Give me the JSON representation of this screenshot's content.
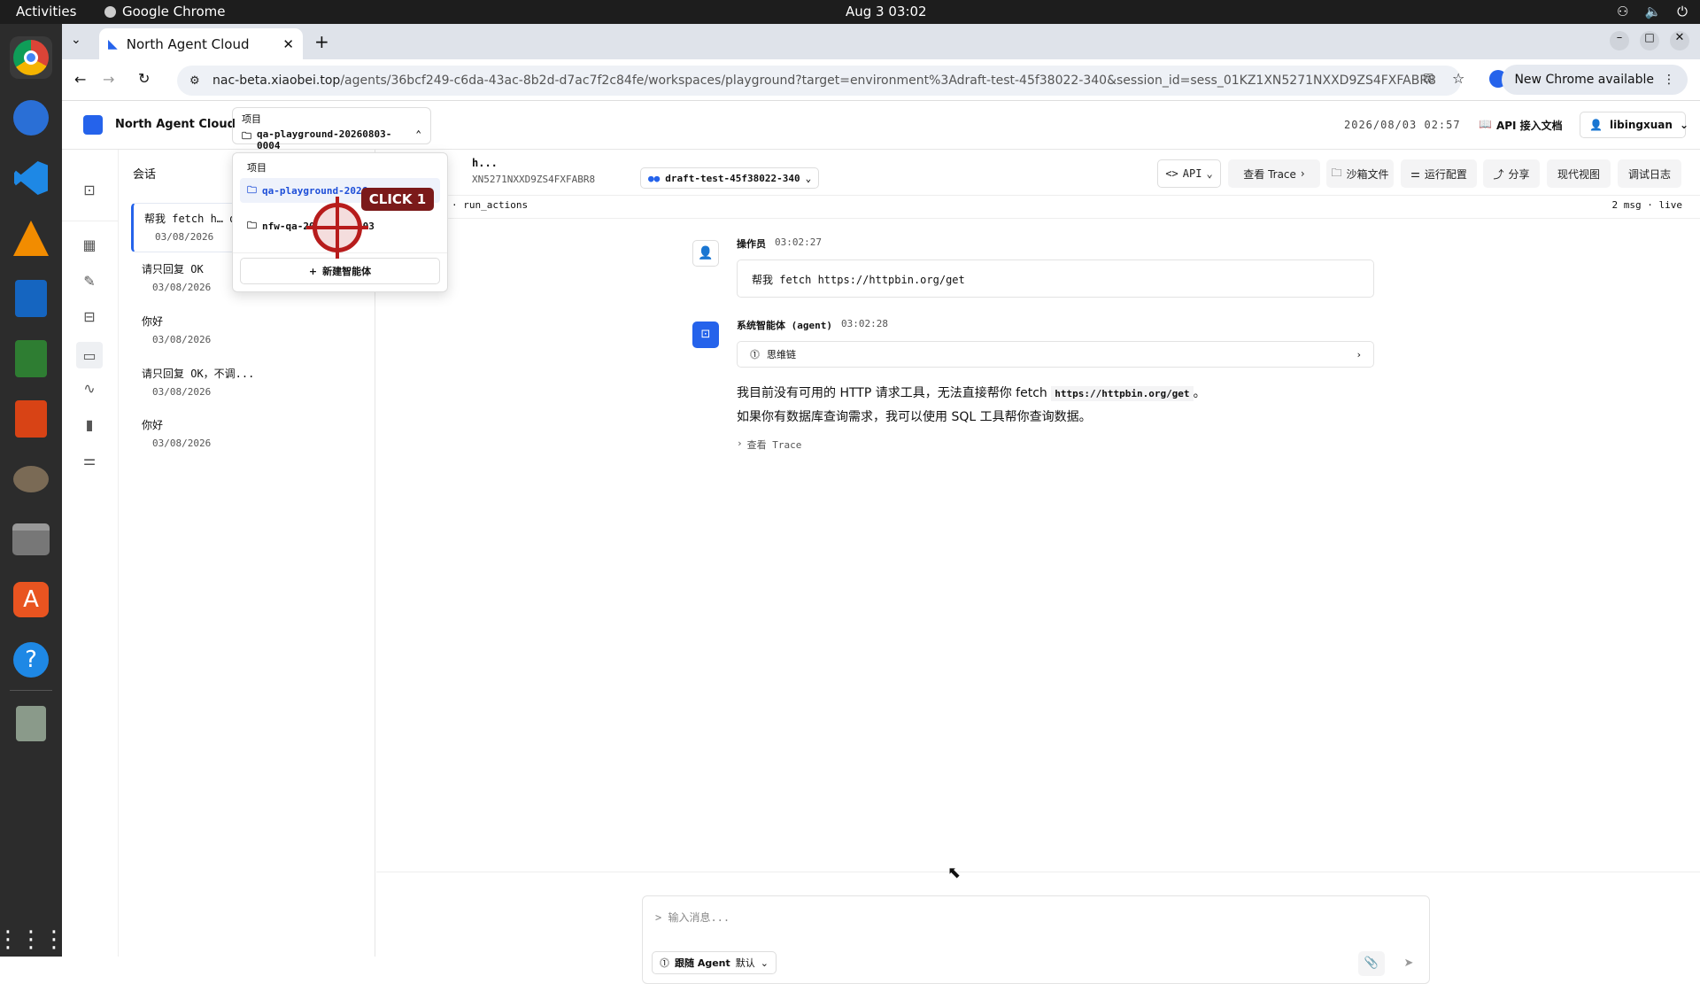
{
  "os": {
    "activities": "Activities",
    "app": "Google Chrome",
    "clock": "Aug 3  03:02"
  },
  "browser": {
    "tab_title": "North Agent Cloud",
    "url_host": "nac-beta.xiaobei.top",
    "url_path": "/agents/36bcf249-c6da-43ac-8b2d-d7ac7f2c84fe/workspaces/playground?target=environment%3Adraft-test-45f38022-340&session_id=sess_01KZ1XN5271NXXD9ZS4FXFABR8",
    "update": "New Chrome available"
  },
  "header": {
    "brand": "North Agent Cloud",
    "project_label": "项目",
    "project_value": "qa-playground-20260803-0004",
    "timestamp": "2026/08/03 02:57",
    "api_docs": "API 接入文档",
    "user": "libingxuan"
  },
  "dropdown": {
    "label": "项目",
    "items": [
      "qa-playground-2026",
      "nfw-qa-20"
    ],
    "item_suffix": "03",
    "new": "新建智能体",
    "click_label": "CLICK 1"
  },
  "sessions": {
    "title": "会话",
    "items": [
      {
        "title": "帮我 fetch h…  dr",
        "date": "03/08/2026"
      },
      {
        "title": "请只回复 OK",
        "date": "03/08/2026"
      },
      {
        "title": "你好",
        "date": "03/08/2026"
      },
      {
        "title": "请只回复 OK，不调...",
        "date": "03/08/2026"
      },
      {
        "title": "你好",
        "date": "03/08/2026"
      }
    ]
  },
  "main": {
    "title": "h...",
    "session_id": "XN5271NXXD9ZS4FXFABR8",
    "env": "draft-test-45f38022-340",
    "crumb": "· run_actions",
    "count": "2 msg · live",
    "buttons": [
      "API",
      "查看 Trace",
      "沙箱文件",
      "运行配置",
      "分享",
      "现代视图",
      "调试日志"
    ],
    "msg1": {
      "author": "操作员",
      "time": "03:02:27",
      "text": "帮我 fetch https://httpbin.org/get"
    },
    "msg2": {
      "author": "系统智能体 (agent)",
      "time": "03:02:28",
      "chain": "思维链",
      "line1a": "我目前没有可用的 HTTP 请求工具，无法直接帮你 fetch ",
      "line1b": "https://httpbin.org/get",
      "line1c": "。",
      "line2": "如果你有数据库查询需求，我可以使用 SQL 工具帮你查询数据。",
      "trace": "查看 Trace"
    },
    "input_placeholder": "> 输入消息...",
    "agent_pill": "跟随 Agent",
    "agent_default": "默认"
  }
}
